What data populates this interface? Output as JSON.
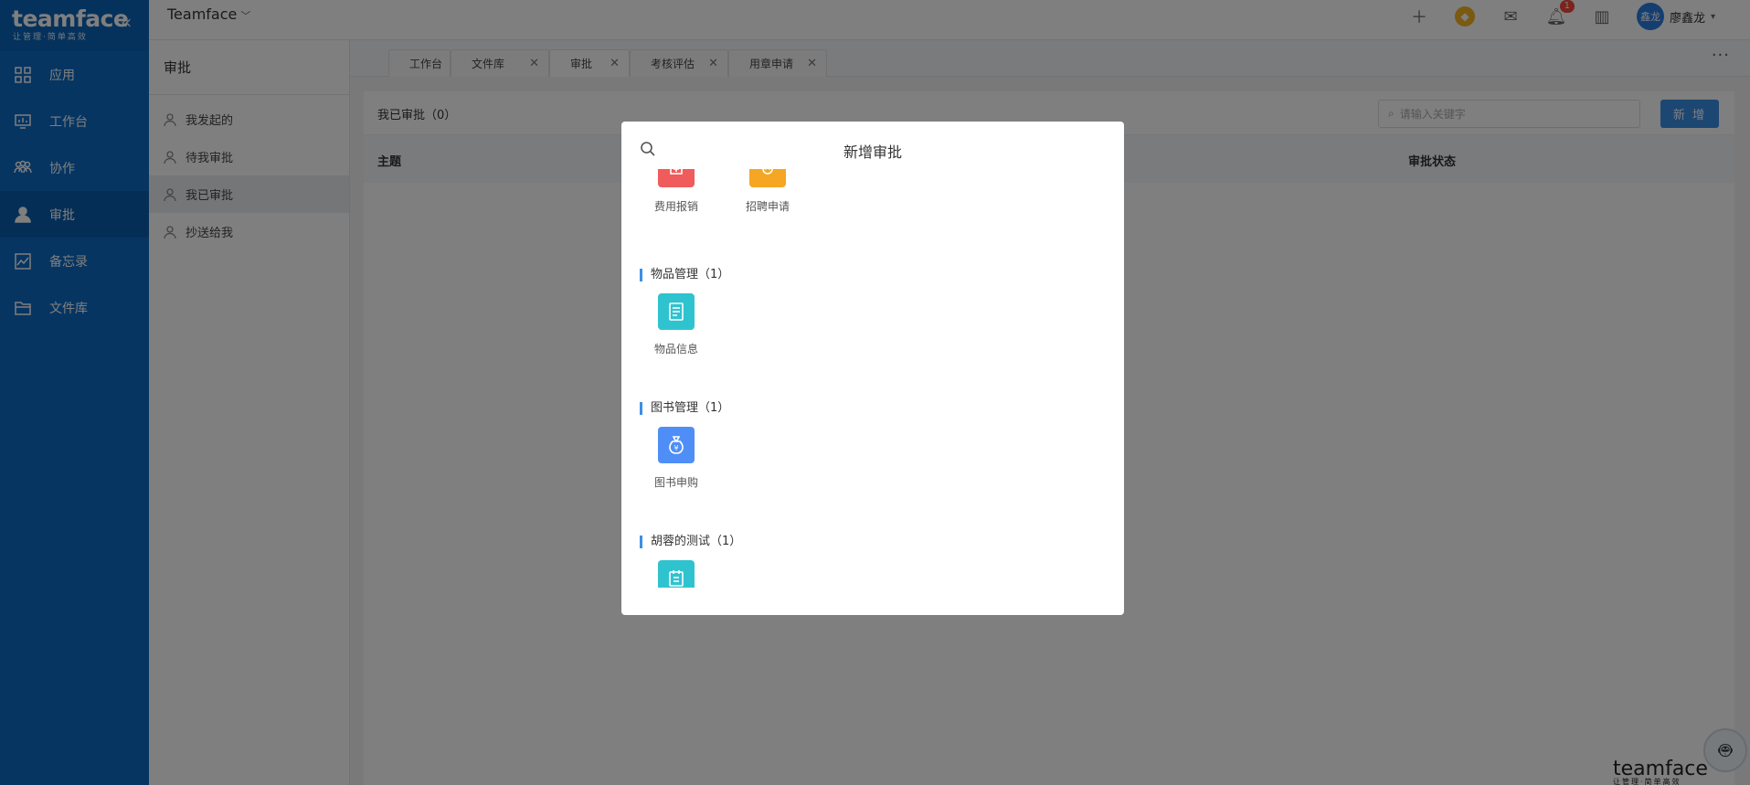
{
  "brand": {
    "name": "teamface",
    "slogan": "让管理·简单高效",
    "collapse_icon": "double-chevron-left-icon"
  },
  "nav": [
    {
      "label": "应用",
      "icon": "grid-icon",
      "active": false
    },
    {
      "label": "工作台",
      "icon": "monitor-icon",
      "active": false
    },
    {
      "label": "协作",
      "icon": "people-icon",
      "active": false
    },
    {
      "label": "审批",
      "icon": "user-icon",
      "active": true
    },
    {
      "label": "备忘录",
      "icon": "chart-icon",
      "active": false
    },
    {
      "label": "文件库",
      "icon": "folder-icon",
      "active": false
    }
  ],
  "topbar": {
    "workspace": "Teamface",
    "notification_count": "1",
    "user_avatar": "鑫龙",
    "user_name": "廖鑫龙"
  },
  "subnav": {
    "title": "审批",
    "items": [
      {
        "label": "我发起的",
        "active": false
      },
      {
        "label": "待我审批",
        "active": false
      },
      {
        "label": "我已审批",
        "active": true
      },
      {
        "label": "抄送给我",
        "active": false
      }
    ]
  },
  "tabs": [
    {
      "label": "工作台",
      "closable": false,
      "active": false
    },
    {
      "label": "文件库",
      "closable": true,
      "active": false
    },
    {
      "label": "审批",
      "closable": true,
      "active": true
    },
    {
      "label": "考核评估",
      "closable": true,
      "active": false
    },
    {
      "label": "用章申请",
      "closable": true,
      "active": false
    }
  ],
  "main": {
    "title": "我已审批（0）",
    "search_placeholder": "请输入关键字",
    "new_button": "新 增",
    "columns": [
      "主题",
      "审批状态"
    ]
  },
  "modal": {
    "title": "新增审批",
    "groups": [
      {
        "title": "",
        "apps": [
          {
            "label": "费用报销",
            "color": "#f05b5b",
            "icon": "receipt-icon"
          },
          {
            "label": "招聘申请",
            "color": "#f5a623",
            "icon": "recruit-icon"
          }
        ]
      },
      {
        "title": "物品管理（1）",
        "apps": [
          {
            "label": "物品信息",
            "color": "#2fc3cf",
            "icon": "document-icon"
          }
        ]
      },
      {
        "title": "图书管理（1）",
        "apps": [
          {
            "label": "图书申购",
            "color": "#4f8ef7",
            "icon": "money-bag-icon"
          }
        ]
      },
      {
        "title": "胡蓉的测试（1）",
        "apps": [
          {
            "label": "",
            "color": "#2fc3cf",
            "icon": "calendar-icon"
          }
        ]
      }
    ]
  },
  "watermark": {
    "brand": "teamface",
    "slogan": "让管理·简单高效"
  },
  "colors": {
    "nav_bg": "#0c6bc4",
    "accent": "#3b8fe6",
    "overlay": "rgba(0,0,0,0.5)"
  }
}
